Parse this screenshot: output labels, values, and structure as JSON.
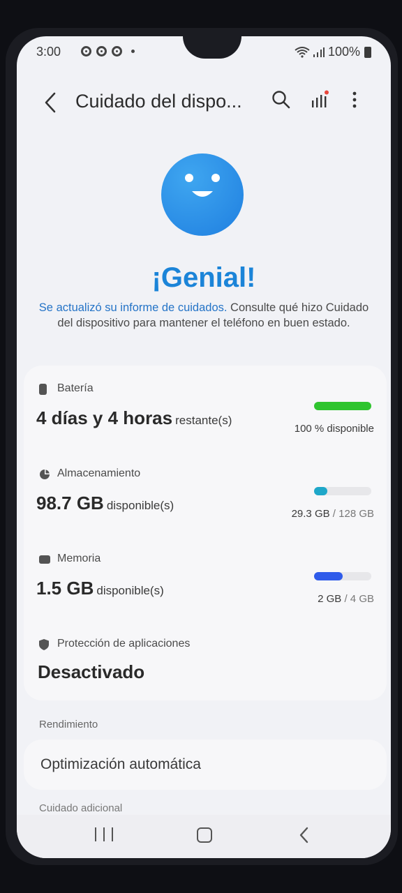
{
  "status_bar": {
    "time": "3:00",
    "battery": "100%"
  },
  "app_bar": {
    "title": "Cuidado del dispo...",
    "icons": [
      "back-icon",
      "search-icon",
      "insights-icon",
      "more-icon"
    ]
  },
  "hero": {
    "headline": "¡Genial!",
    "desc_link": "Se actualizó su informe de cuidados.",
    "desc_text": " Consulte qué hizo Cuidado del dispositivo para mantener el teléfono en buen estado.",
    "icon": "smiley-icon"
  },
  "battery": {
    "label": "Batería",
    "value": "4 días y 4 horas",
    "unit": "restante(s)",
    "stat": "100 % disponible",
    "level": 1.0,
    "color": "#2fc42f"
  },
  "storage": {
    "label": "Almacenamiento",
    "value": "98.7 GB",
    "unit": "disponible(s)",
    "used": "29.3 GB",
    "total": "/ 128 GB",
    "level": 0.229,
    "color": "#1ea7c9"
  },
  "memory": {
    "label": "Memoria",
    "value": "1.5 GB",
    "unit": "disponible(s)",
    "used": "2 GB",
    "total": "/ 4 GB",
    "level": 0.5,
    "color": "#2f5bea"
  },
  "protection": {
    "label": "Protección de aplicaciones",
    "value": "Desactivado"
  },
  "performance": {
    "section_label": "Rendimiento",
    "item": "Optimización automática"
  },
  "additional": {
    "section_label": "Cuidado adicional"
  },
  "nav": {
    "icons": [
      "recent-apps-icon",
      "home-icon",
      "back-icon"
    ]
  }
}
